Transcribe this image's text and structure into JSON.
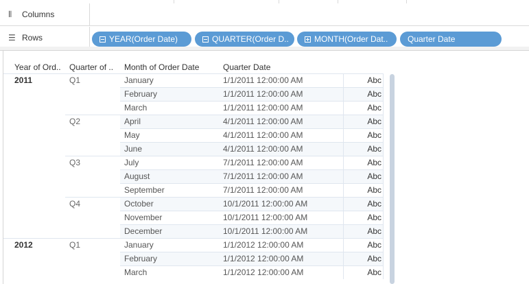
{
  "shelves": {
    "columns": {
      "label": "Columns",
      "icon": "columns-icon"
    },
    "rows": {
      "label": "Rows",
      "icon": "rows-icon"
    }
  },
  "pills": [
    {
      "label": "YEAR(Order Date)",
      "toggle": "minus"
    },
    {
      "label": "QUARTER(Order D..",
      "toggle": "minus"
    },
    {
      "label": "MONTH(Order Dat..",
      "toggle": "plus"
    },
    {
      "label": "Quarter Date",
      "toggle": "none"
    }
  ],
  "table": {
    "headers": [
      "Year of Ord..",
      "Quarter of ..",
      "Month of Order Date",
      "Quarter Date"
    ],
    "rows": [
      {
        "year": "2011",
        "quarter": "Q1",
        "month": "January",
        "date": "1/1/2011 12:00:00 AM",
        "value": "Abc"
      },
      {
        "year": "",
        "quarter": "",
        "month": "February",
        "date": "1/1/2011 12:00:00 AM",
        "value": "Abc"
      },
      {
        "year": "",
        "quarter": "",
        "month": "March",
        "date": "1/1/2011 12:00:00 AM",
        "value": "Abc"
      },
      {
        "year": "",
        "quarter": "Q2",
        "month": "April",
        "date": "4/1/2011 12:00:00 AM",
        "value": "Abc"
      },
      {
        "year": "",
        "quarter": "",
        "month": "May",
        "date": "4/1/2011 12:00:00 AM",
        "value": "Abc"
      },
      {
        "year": "",
        "quarter": "",
        "month": "June",
        "date": "4/1/2011 12:00:00 AM",
        "value": "Abc"
      },
      {
        "year": "",
        "quarter": "Q3",
        "month": "July",
        "date": "7/1/2011 12:00:00 AM",
        "value": "Abc"
      },
      {
        "year": "",
        "quarter": "",
        "month": "August",
        "date": "7/1/2011 12:00:00 AM",
        "value": "Abc"
      },
      {
        "year": "",
        "quarter": "",
        "month": "September",
        "date": "7/1/2011 12:00:00 AM",
        "value": "Abc"
      },
      {
        "year": "",
        "quarter": "Q4",
        "month": "October",
        "date": "10/1/2011 12:00:00 AM",
        "value": "Abc"
      },
      {
        "year": "",
        "quarter": "",
        "month": "November",
        "date": "10/1/2011 12:00:00 AM",
        "value": "Abc"
      },
      {
        "year": "",
        "quarter": "",
        "month": "December",
        "date": "10/1/2011 12:00:00 AM",
        "value": "Abc"
      },
      {
        "year": "2012",
        "quarter": "Q1",
        "month": "January",
        "date": "1/1/2012 12:00:00 AM",
        "value": "Abc"
      },
      {
        "year": "",
        "quarter": "",
        "month": "February",
        "date": "1/1/2012 12:00:00 AM",
        "value": "Abc"
      },
      {
        "year": "",
        "quarter": "",
        "month": "March",
        "date": "1/1/2012 12:00:00 AM",
        "value": "Abc"
      }
    ]
  },
  "colors": {
    "pill": "#5b9bd5",
    "band": "#f5f8fb",
    "gridline": "#dfe6ef",
    "scrollbar": "#c8d3e0"
  }
}
